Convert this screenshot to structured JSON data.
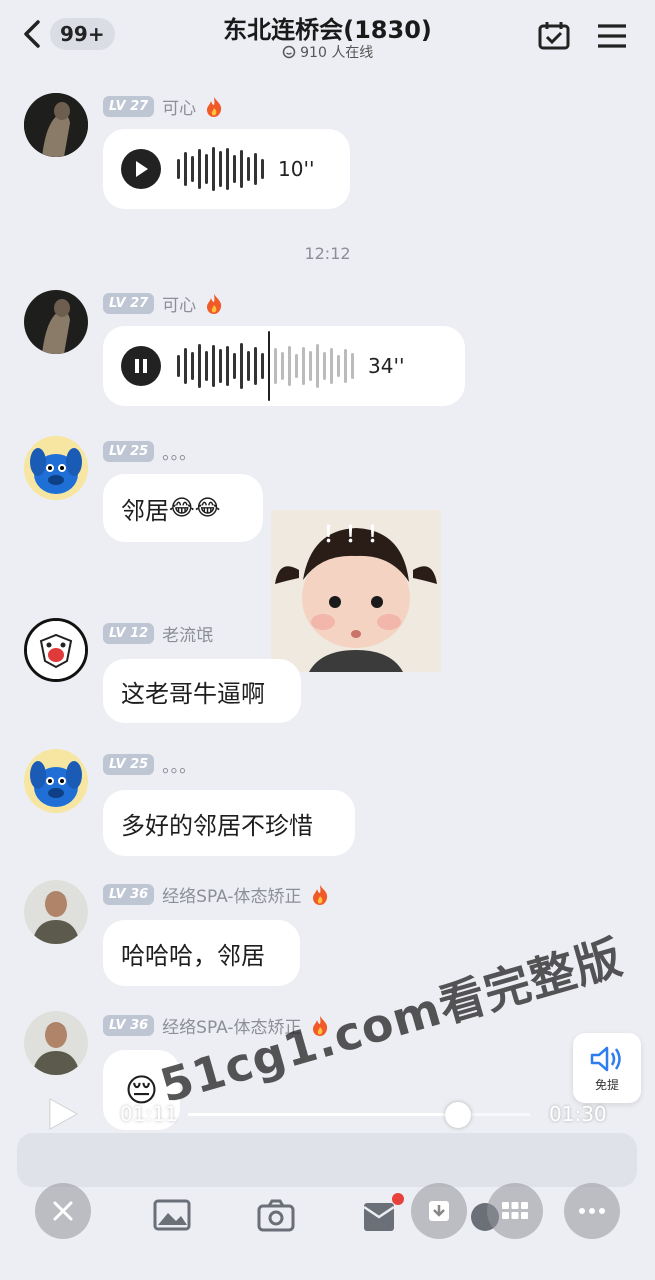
{
  "header": {
    "back_badge": "99+",
    "title": "东北连桥会(1830)",
    "online": "910 人在线"
  },
  "messages": [
    {
      "level": "LV 27",
      "nickname": "可心",
      "type": "voice",
      "duration": "10''",
      "playing": false
    },
    {
      "type": "time",
      "text": "12:12"
    },
    {
      "level": "LV 27",
      "nickname": "可心",
      "type": "voice",
      "duration": "34''",
      "playing": true
    },
    {
      "level": "LV 25",
      "nickname": "。。。",
      "type": "text",
      "text": "邻居",
      "emoji": "😂😂"
    },
    {
      "type": "sticker",
      "text": "！！！"
    },
    {
      "level": "LV 12",
      "nickname": "老流氓",
      "type": "text",
      "text": "这老哥牛逼啊"
    },
    {
      "level": "LV 25",
      "nickname": "。。。",
      "type": "text",
      "text": "多好的邻居不珍惜"
    },
    {
      "level": "LV 36",
      "nickname": "经络SPA-体态矫正",
      "type": "text",
      "text": "哈哈哈，邻居"
    },
    {
      "level": "LV 36",
      "nickname": "经络SPA-体态矫正",
      "type": "emoji",
      "text": "😔"
    }
  ],
  "player": {
    "current_time": "01:11",
    "total_time": "01:30",
    "progress": 0.79
  },
  "watermark": "51cg1.com看完整版",
  "tts_label": "免提",
  "colors": {
    "background": "#eceef3",
    "bubble": "#ffffff",
    "level_badge": "#bfc6d3",
    "notification_dot": "#e8403a"
  }
}
